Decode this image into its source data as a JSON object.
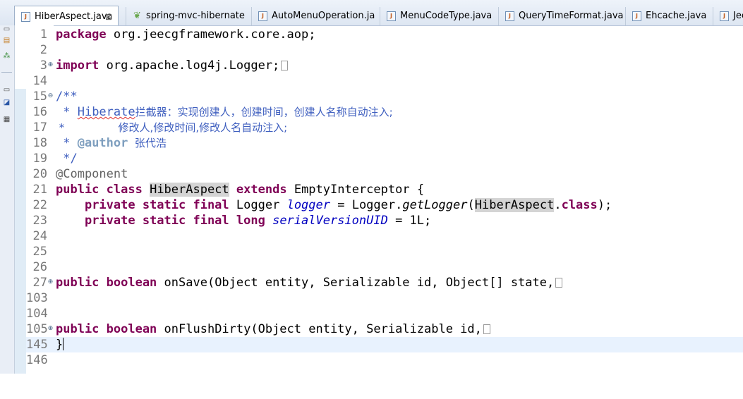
{
  "tabs": [
    {
      "label": "HiberAspect.java",
      "active": true,
      "close": "⊠"
    },
    {
      "label": "spring-mvc-hibernate"
    },
    {
      "label": "AutoMenuOperation.ja"
    },
    {
      "label": "MenuCodeType.java"
    },
    {
      "label": "QueryTimeFormat.java"
    },
    {
      "label": "Ehcache.java"
    },
    {
      "label": "Jee"
    }
  ],
  "editor": {
    "lines": [
      {
        "n": "1",
        "code": "package org.jeecgframework.core.aop;"
      },
      {
        "n": "2",
        "code": ""
      },
      {
        "n": "3",
        "code": "import org.apache.log4j.Logger;",
        "folded": true
      },
      {
        "n": "14",
        "code": ""
      },
      {
        "n": "15",
        "code": "/**",
        "folded": true
      },
      {
        "n": "16",
        "code_prefix": " * ",
        "code_word": "Hiberate",
        "code_rest": "拦截器：实现创建人，创建时间，创建人名称自动注入;"
      },
      {
        "n": "17",
        "code": " *                修改人,修改时间,修改人名自动注入;"
      },
      {
        "n": "18",
        "code_prefix": " * ",
        "code_tag": "@author",
        "code_rest": "  张代浩"
      },
      {
        "n": "19",
        "code": " */"
      },
      {
        "n": "20",
        "code": "@Component"
      },
      {
        "n": "21",
        "kw1": "public class",
        "cls": "HiberAspect",
        "kw2": "extends",
        "rest": "EmptyInterceptor {"
      },
      {
        "n": "22",
        "kw": "private static final",
        "type": "Logger",
        "field": "logger",
        "eq": " = Logger.",
        "method": "getLogger",
        "open": "(",
        "cls": "HiberAspect",
        "dot": ".",
        "kw2": "class",
        "close": ");"
      },
      {
        "n": "23",
        "kw": "private static final long",
        "field": "serialVersionUID",
        "rest": " = 1L;"
      },
      {
        "n": "24",
        "code": ""
      },
      {
        "n": "25",
        "code": ""
      },
      {
        "n": "26",
        "code": ""
      },
      {
        "n": "27",
        "kw": "public boolean",
        "rest": "onSave(Object entity, Serializable id, Object[] state,",
        "folded": true
      },
      {
        "n": "103",
        "code": ""
      },
      {
        "n": "104",
        "code": ""
      },
      {
        "n": "105",
        "kw": "public boolean",
        "rest": "onFlushDirty(Object entity, Serializable id,",
        "folded": true
      },
      {
        "n": "145",
        "code": "}"
      },
      {
        "n": "146",
        "code": ""
      }
    ]
  }
}
